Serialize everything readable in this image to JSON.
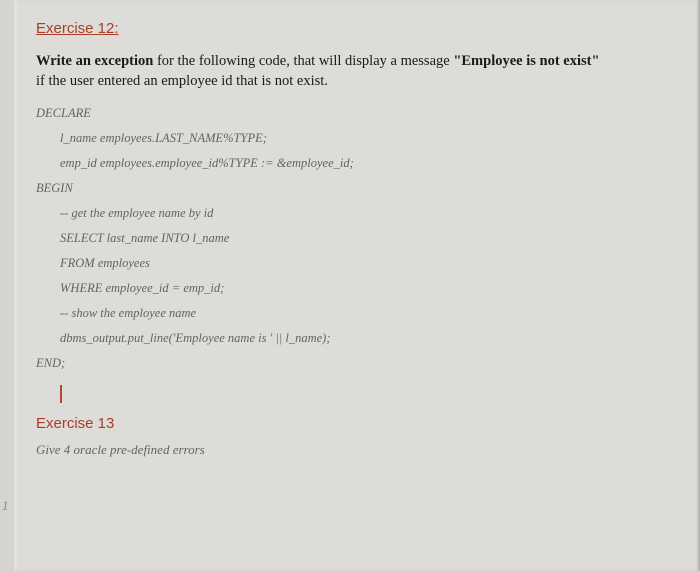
{
  "ex12": {
    "heading": "Exercise 12:",
    "instr_lead": "Write an exception",
    "instr_mid": " for the following code, that will display a message ",
    "instr_quote": "\"Employee is not exist\"",
    "instr_tail": "if the user entered an employee id that is not exist."
  },
  "code": {
    "declare": "DECLARE",
    "l1": "l_name employees.LAST_NAME%TYPE;",
    "l2": "emp_id employees.employee_id%TYPE := &employee_id;",
    "begin": "BEGIN",
    "c1": "-- get the employee name by id",
    "s1": "SELECT last_name INTO l_name",
    "s2": "FROM employees",
    "s3": "WHERE employee_id = emp_id;",
    "c2": "-- show the employee name",
    "s4": "dbms_output.put_line('Employee name is ' || l_name);",
    "end": "END;"
  },
  "ex13": {
    "heading": "Exercise 13",
    "text": "Give 4 oracle pre-defined errors"
  },
  "gutter": "1"
}
